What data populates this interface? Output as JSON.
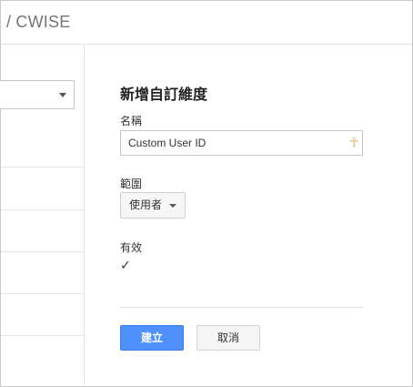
{
  "header": {
    "breadcrumb": "/ CWISE"
  },
  "form": {
    "title": "新增自訂維度",
    "name_label": "名稱",
    "name_value": "Custom User ID",
    "scope_label": "範圍",
    "scope_value": "使用者",
    "active_label": "有效",
    "active_checked": true,
    "create_button": "建立",
    "cancel_button": "取消"
  },
  "icons": {
    "input_icon": "ankh-icon",
    "checkbox_icon": "checkmark-icon",
    "dropdown_icon": "caret-down-icon"
  },
  "colors": {
    "primary_button": "#4d90fe",
    "breadcrumb_text": "#757575"
  }
}
